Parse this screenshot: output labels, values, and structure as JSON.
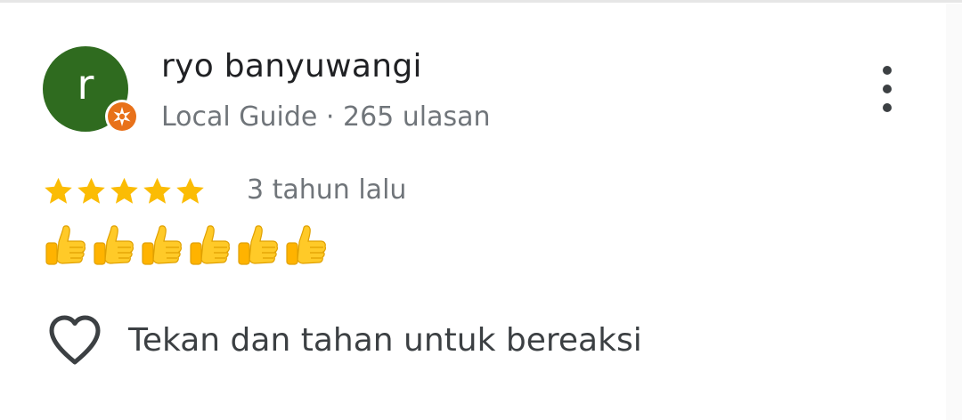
{
  "reviewer": {
    "initial": "r",
    "name": "ryo banyuwangi",
    "meta": "Local Guide · 265 ulasan",
    "avatar_color": "#2f6b1f",
    "badge_color": "#e8711a"
  },
  "review": {
    "rating": 5,
    "rating_max": 5,
    "time": "3 tahun lalu",
    "text_emoji": "👍👍👍👍👍👍",
    "thumb_count": 6
  },
  "reaction": {
    "icon": "heart-outline-icon",
    "label": "Tekan dan tahan untuk bereaksi"
  },
  "menu": {
    "icon": "more-vert-icon"
  },
  "colors": {
    "star": "#fbbc04",
    "text_primary": "#202124",
    "text_secondary": "#70757a"
  }
}
